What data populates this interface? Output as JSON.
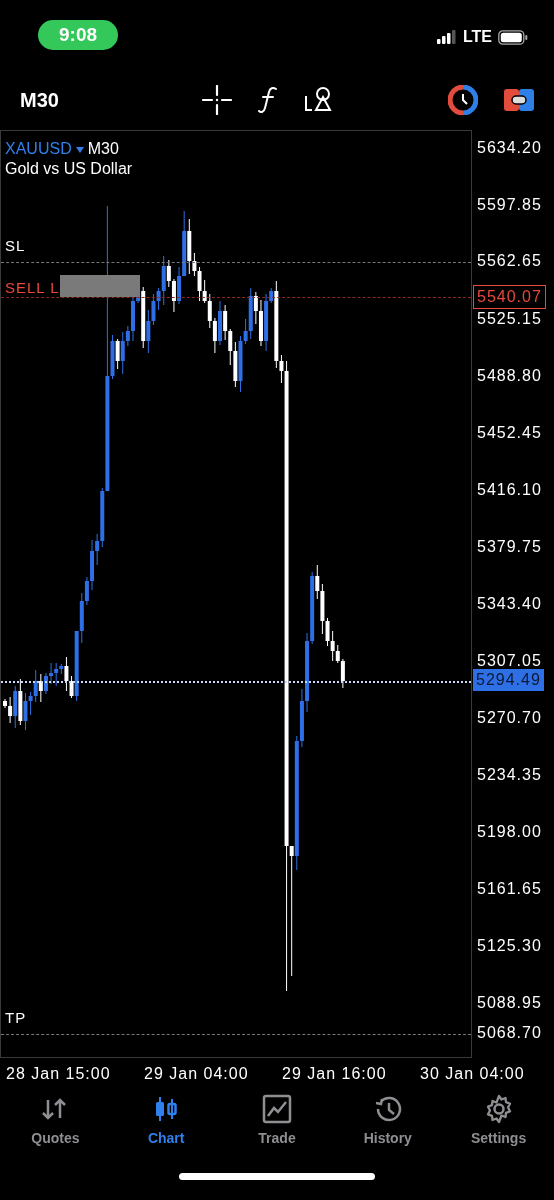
{
  "status_bar": {
    "time": "9:08",
    "network": "LTE"
  },
  "toolbar": {
    "timeframe": "M30"
  },
  "chart": {
    "symbol": "XAUUSD",
    "timeframe": "M30",
    "description": "Gold vs US Dollar",
    "price_ticks": [
      "5634.20",
      "5597.85",
      "5525.15",
      "5488.80",
      "5452.45",
      "5416.10",
      "5379.75",
      "5343.40",
      "5307.05",
      "5270.70",
      "5234.35",
      "5198.00",
      "5161.65",
      "5125.30",
      "5088.95"
    ],
    "price_levels": [
      {
        "kind": "sl",
        "label": "SL",
        "price": "5562.65"
      },
      {
        "kind": "sell",
        "label": "SELL L",
        "price": "5540.07"
      },
      {
        "kind": "current",
        "price": "5294.49"
      },
      {
        "kind": "tp",
        "label": "TP",
        "price": "5068.70"
      }
    ],
    "time_ticks": [
      "28 Jan 15:00",
      "29 Jan 04:00",
      "29 Jan 16:00",
      "30 Jan 04:00"
    ]
  },
  "tabs": [
    {
      "label": "Quotes",
      "kind": "quotes",
      "selected": false
    },
    {
      "label": "Chart",
      "kind": "chart",
      "selected": true
    },
    {
      "label": "Trade",
      "kind": "trade",
      "selected": false
    },
    {
      "label": "History",
      "kind": "history",
      "selected": false
    },
    {
      "label": "Settings",
      "kind": "settings",
      "selected": false
    }
  ]
}
